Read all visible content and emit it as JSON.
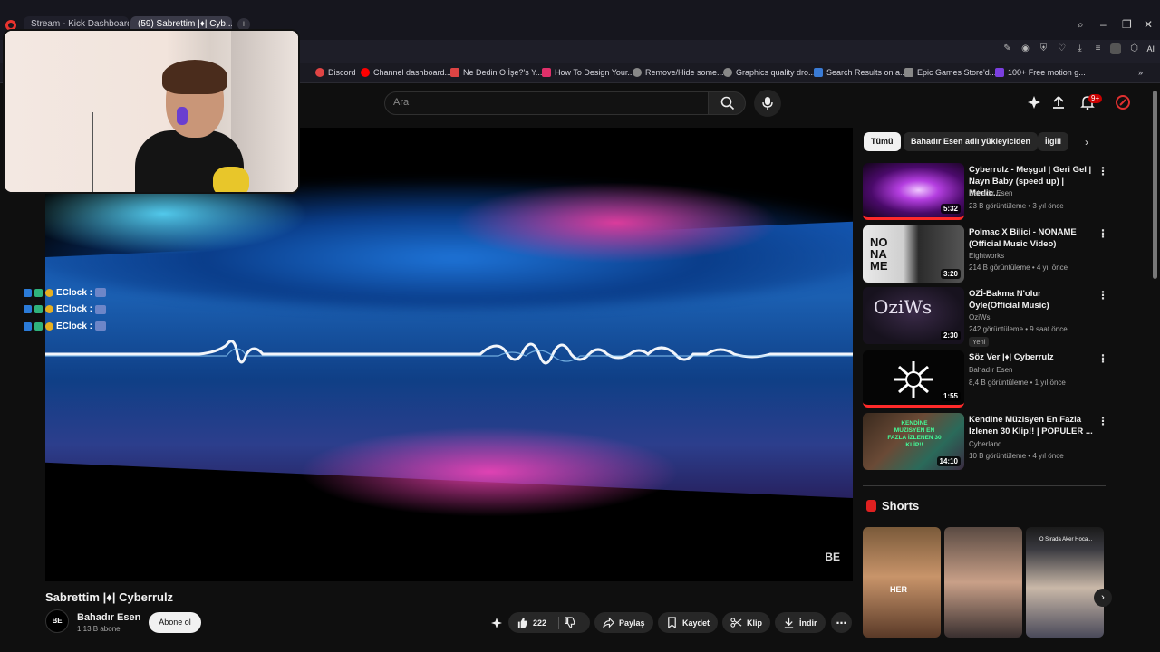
{
  "browser": {
    "tabs": [
      {
        "label": "Stream - Kick Dashboard"
      },
      {
        "label": "(59) Sabrettim |♦| Cyb..."
      }
    ],
    "bookmarks": [
      {
        "label": "Discord"
      },
      {
        "label": "Channel dashboard..."
      },
      {
        "label": "Ne Dedin O İşe?'s Y..."
      },
      {
        "label": "How To Design Your..."
      },
      {
        "label": "Remove/Hide some..."
      },
      {
        "label": "Graphics quality dro..."
      },
      {
        "label": "Search Results on a..."
      },
      {
        "label": "Epic Games Store'd..."
      },
      {
        "label": "100+ Free motion g..."
      }
    ],
    "ai_label": "AI"
  },
  "youtube": {
    "search_placeholder": "Ara",
    "notification_count": "9+"
  },
  "chat": {
    "rows": [
      {
        "user": "EClock :"
      },
      {
        "user": "EClock :"
      },
      {
        "user": "EClock :"
      }
    ]
  },
  "player": {
    "logo": "BE"
  },
  "video": {
    "title": "Sabrettim |♦| Cyberrulz",
    "channel_name": "Bahadır Esen",
    "channel_avatar": "BE",
    "subscribers": "1,13 B abone",
    "subscribe_label": "Abone ol",
    "like_count": "222",
    "share_label": "Paylaş",
    "save_label": "Kaydet",
    "clip_label": "Klip",
    "download_label": "İndir"
  },
  "sidebar": {
    "chips": [
      {
        "label": "Tümü"
      },
      {
        "label": "Bahadır Esen adlı yükleyiciden"
      },
      {
        "label": "İlgili"
      }
    ],
    "recommendations": [
      {
        "title": "Cyberrulz - Meşgul | Geri Gel | Nayn Baby (speed up) | Medic...",
        "channel": "Bahadır Esen",
        "meta": "23 B görüntüleme • 3 yıl önce",
        "duration": "5:32"
      },
      {
        "title": "Polmac X Bilici - NONAME (Official Music Video)",
        "channel": "Eightworks",
        "meta": "214 B görüntüleme • 4 yıl önce",
        "duration": "3:20",
        "thumb_text": "NO NA ME"
      },
      {
        "title": "OZİ-Bakma N'olur Öyle(Official Music)",
        "channel": "OziWs",
        "meta": "242 görüntüleme • 9 saat önce",
        "duration": "2:30",
        "badge": "Yeni",
        "thumb_text": "OziWs"
      },
      {
        "title": "Söz Ver |♦| Cyberrulz",
        "channel": "Bahadır Esen",
        "meta": "8,4 B görüntüleme • 1 yıl önce",
        "duration": "1:55"
      },
      {
        "title": "Kendine Müzisyen En Fazla İzlenen 30 Klip!! | POPÜLER ...",
        "channel": "Cyberland",
        "meta": "10 B görüntüleme • 4 yıl önce",
        "duration": "14:10",
        "thumb_text": "KENDİNE MÜZİSYEN EN FAZLA İZLENEN 30 KLİP!!"
      }
    ],
    "shorts_title": "Shorts",
    "shorts": [
      {
        "caption": "HER"
      },
      {
        "caption": ""
      },
      {
        "caption": "O Sırada Aker Hoca..."
      }
    ]
  }
}
